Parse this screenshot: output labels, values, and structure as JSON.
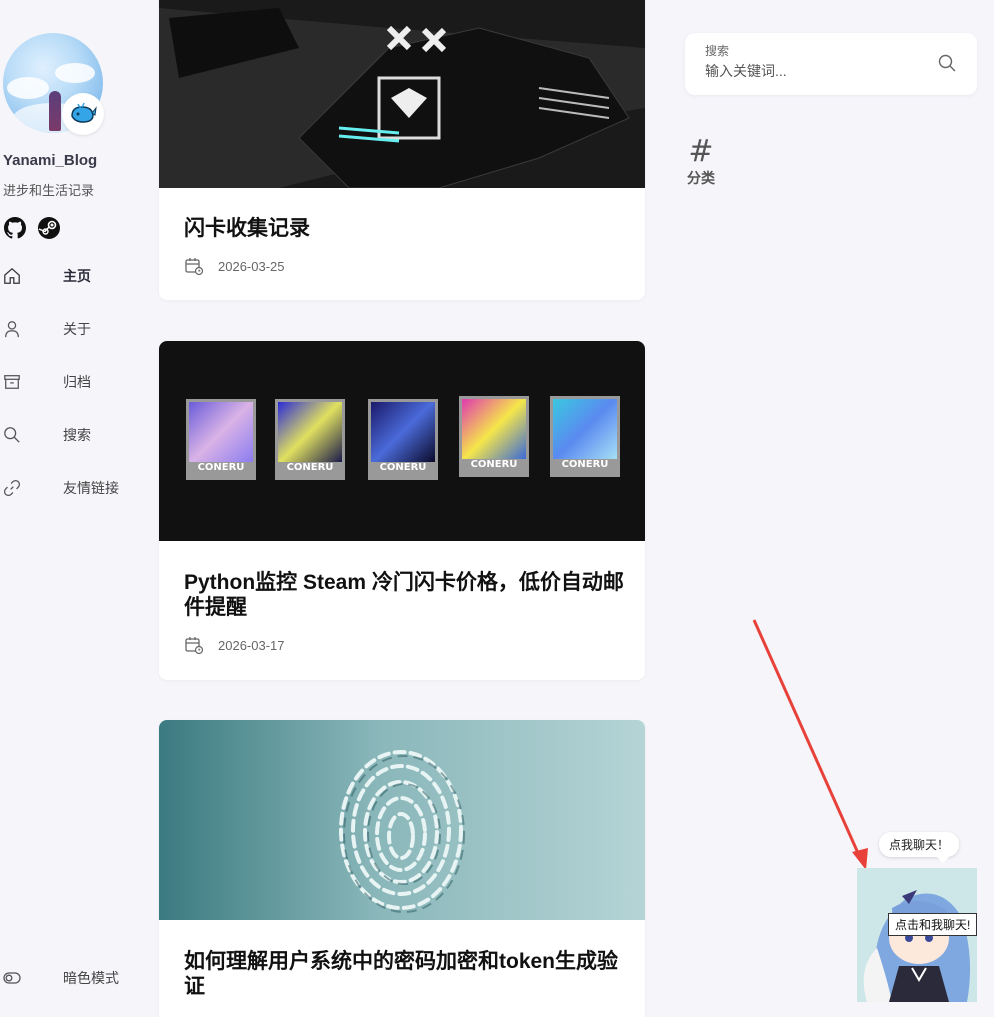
{
  "sidebar": {
    "blog_name": "Yanami_Blog",
    "blog_desc": "进步和生活记录",
    "nav": [
      {
        "label": "主页",
        "icon": "home-icon",
        "active": true
      },
      {
        "label": "关于",
        "icon": "user-icon"
      },
      {
        "label": "归档",
        "icon": "archive-icon"
      },
      {
        "label": "搜索",
        "icon": "search-icon"
      },
      {
        "label": "友情链接",
        "icon": "link-icon"
      }
    ],
    "dark_mode_label": "暗色模式"
  },
  "posts": [
    {
      "title": "闪卡收集记录",
      "date": "2026-03-25"
    },
    {
      "title": "Python监控 Steam 冷门闪卡价格，低价自动邮件提醒",
      "date": "2026-03-17",
      "card_label": "CONERU"
    },
    {
      "title": "如何理解用户系统中的密码加密和token生成验证"
    }
  ],
  "search": {
    "label": "搜索",
    "placeholder": "输入关键词..."
  },
  "categories": {
    "label": "分类"
  },
  "chat": {
    "bubble": "点我聊天！",
    "tooltip": "点击和我聊天!"
  },
  "colors": {
    "background": "#f5f5fa",
    "arrow": "#e8413a",
    "steam_card_bg": "#111111",
    "fingerprint_bg": "#5a9aa0"
  }
}
